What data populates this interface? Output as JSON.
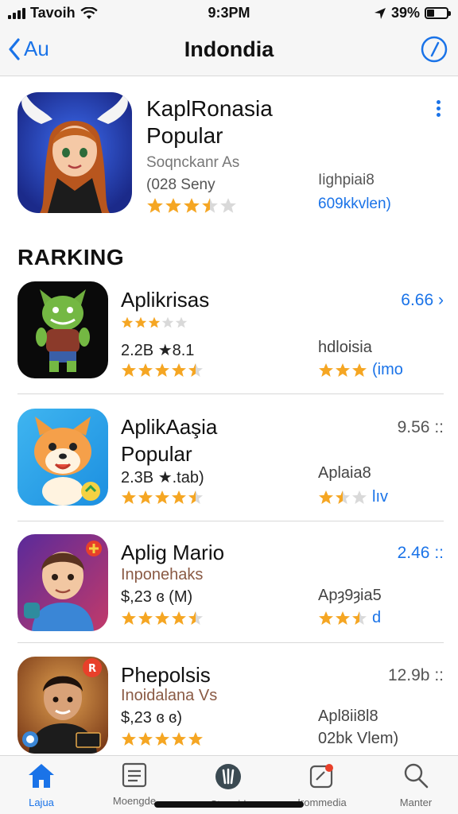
{
  "status_bar": {
    "carrier": "Tavoih",
    "time": "9:3PM",
    "battery": "39%",
    "battery_level": 0.39
  },
  "nav": {
    "back_label": "Au",
    "title": "Indondia"
  },
  "featured": {
    "title_line1": "KaplRonasia",
    "title_line2": "Popular",
    "subtitle": "Soqnckanr As",
    "meta": "(028 Seny",
    "right_line1": "Iighpiai8",
    "right_line2": "609kkvlen)",
    "rating": 3.5
  },
  "section_heading": "RARKING",
  "rows": [
    {
      "title_line1": "Aplikrisas",
      "title_line2": "",
      "line2": "2.2B ★8.1",
      "right_top": "6.66 ›",
      "right_mid": "hdloisia",
      "right_bot": "(imo",
      "rating_a": 3.0,
      "rating_b": 4.5,
      "right_rating": 3
    },
    {
      "title_line1": "AplikAaşia",
      "title_line2": "Popular",
      "line2": "2.3B ★.tab)",
      "right_top": "9.56 ::",
      "right_mid": "Aplaia8",
      "right_bot": "lıv",
      "rating_b": 4.5,
      "right_rating": 1.5
    },
    {
      "title_line1": "Aplig Mario",
      "title_line2": "",
      "line_muted": "Inponehaks",
      "line2": "$,23 ɞ (M)",
      "right_top": "2.46 ::",
      "right_mid": "Apȝ9ȝia5",
      "right_bot": "d",
      "rating_b": 4.5,
      "right_rating": 2.5
    },
    {
      "title_line1": "Phepolsis",
      "title_line2": "",
      "line_muted": "Inoidalana Vs",
      "line2": "$,23 ɞ ɞ)",
      "right_top": "12.9b ::",
      "right_mid": "Apl8ii8l8",
      "right_bot": "02bk Vlem)",
      "rating_b": 5
    }
  ],
  "tabs": [
    {
      "label": "Lajua",
      "icon": "home-icon",
      "active": true
    },
    {
      "label": "Moengde",
      "icon": "list-icon",
      "active": false
    },
    {
      "label": "Stemrid",
      "icon": "games-icon",
      "active": false
    },
    {
      "label": "Irommedia",
      "icon": "updates-icon",
      "active": false
    },
    {
      "label": "Manter",
      "icon": "search-icon",
      "active": false
    }
  ],
  "colors": {
    "accent": "#1a73e8",
    "star": "#f5a623",
    "star_empty": "#d9d9d9"
  }
}
